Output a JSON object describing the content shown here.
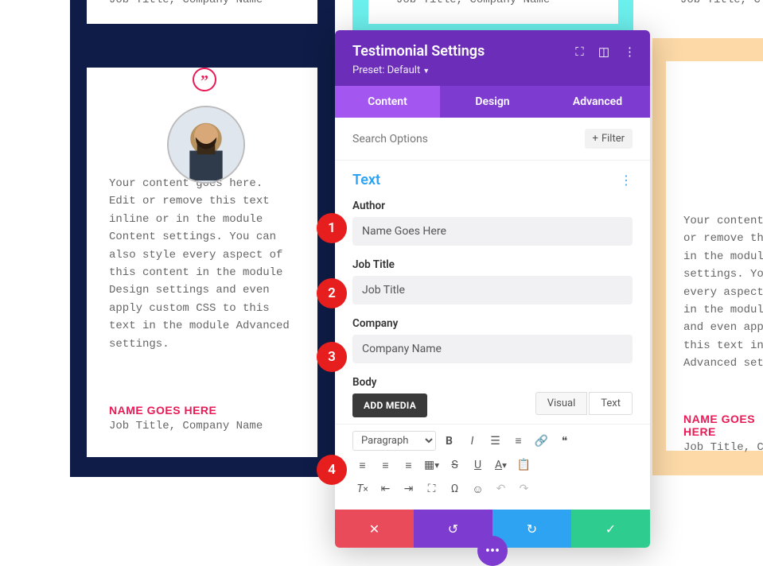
{
  "bg_cards": {
    "name": "NAME GOES HERE",
    "job_line": "Job Title, Company Name",
    "job_line_trunc": "Job Title, C",
    "body_text": "Your content goes here. Edit or remove this text inline or in the module Content settings. You can also style every aspect of this content in the module Design settings and even apply custom CSS to this text in the module Advanced settings.",
    "body_text_trunc": "Your content\nor remove th\nin the modul\nsettings. Yo\nevery aspect\nin the modul\nand even app\nthis text in\nAdvanced set",
    "quote_glyph": "”"
  },
  "panel": {
    "title": "Testimonial Settings",
    "preset": "Preset: Default",
    "tabs": [
      "Content",
      "Design",
      "Advanced"
    ],
    "search_placeholder": "Search Options",
    "filter_label": "Filter",
    "section": "Text",
    "fields": {
      "author_label": "Author",
      "author_value": "Name Goes Here",
      "job_label": "Job Title",
      "job_value": "Job Title",
      "company_label": "Company",
      "company_value": "Company Name",
      "body_label": "Body",
      "add_media": "ADD MEDIA",
      "ed_visual": "Visual",
      "ed_text": "Text",
      "paragraph": "Paragraph"
    }
  },
  "markers": {
    "m1": "1",
    "m2": "2",
    "m3": "3",
    "m4": "4"
  }
}
